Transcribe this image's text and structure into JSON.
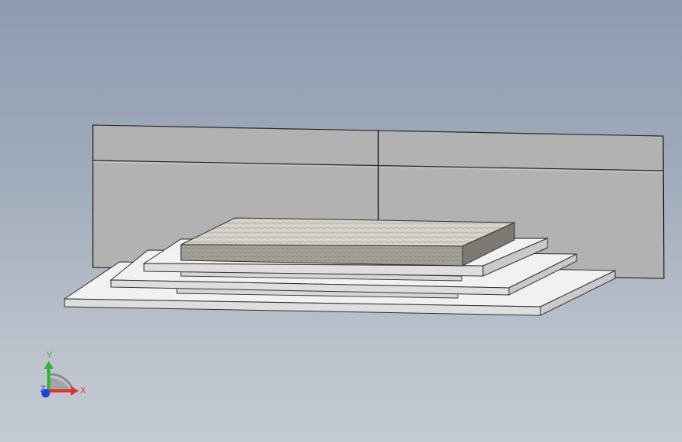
{
  "viewport": {
    "background_top": "#8d9cb1",
    "background_bottom": "#c4cad3"
  },
  "model": {
    "back_panel_color": "#b2b2b2",
    "back_panel_line_color": "#2a2a2a",
    "plate_top_color": "#f1f1f1",
    "plate_side_color": "#c9c9c9",
    "plate_front_color": "#dedede",
    "textured_block_top_color": "#d3cfc6",
    "textured_block_front_color": "#9e9a92"
  },
  "triad": {
    "x_label": "X",
    "y_label": "Y",
    "z_label": "Z",
    "x_color": "#e0312a",
    "y_color": "#2fb63a",
    "z_color": "#2244d8",
    "x_icon": "x-axis-arrow-icon",
    "y_icon": "y-axis-arrow-icon",
    "z_icon": "z-axis-dot-icon"
  }
}
